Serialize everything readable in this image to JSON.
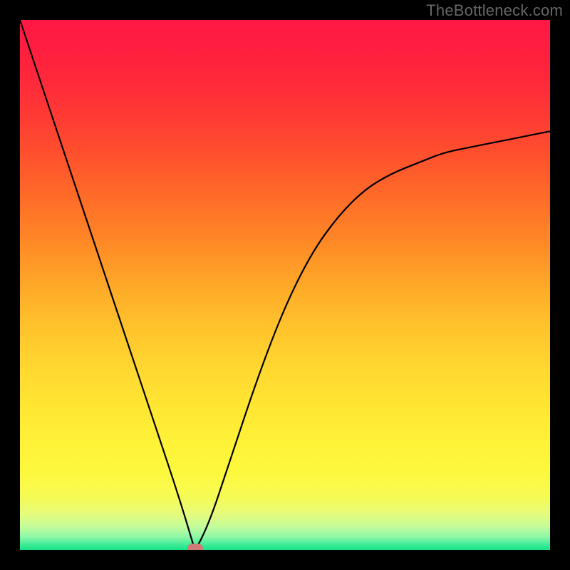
{
  "watermark": "TheBottleneck.com",
  "chart_data": {
    "type": "line",
    "title": "",
    "xlabel": "",
    "ylabel": "",
    "xlim": [
      0,
      100
    ],
    "ylim": [
      0,
      100
    ],
    "x": [
      0,
      5,
      10,
      15,
      20,
      25,
      30,
      33,
      35,
      40,
      45,
      50,
      55,
      60,
      65,
      70,
      75,
      80,
      85,
      90,
      95,
      100
    ],
    "values": [
      100,
      85,
      70,
      55,
      40,
      25,
      10,
      0,
      3,
      18,
      33,
      46,
      56,
      63,
      68,
      71,
      73,
      75,
      76,
      77,
      78,
      79
    ],
    "optimum_x": 33,
    "optimum_y": 0,
    "background_gradient": {
      "stops": [
        {
          "pos": 0.0,
          "color": "#ff1744"
        },
        {
          "pos": 0.06,
          "color": "#ff1f3f"
        },
        {
          "pos": 0.12,
          "color": "#ff2a3a"
        },
        {
          "pos": 0.18,
          "color": "#ff3a34"
        },
        {
          "pos": 0.25,
          "color": "#ff4f2e"
        },
        {
          "pos": 0.33,
          "color": "#ff6a28"
        },
        {
          "pos": 0.42,
          "color": "#ff8926"
        },
        {
          "pos": 0.5,
          "color": "#ffa828"
        },
        {
          "pos": 0.58,
          "color": "#ffc32c"
        },
        {
          "pos": 0.66,
          "color": "#ffd830"
        },
        {
          "pos": 0.74,
          "color": "#ffe833"
        },
        {
          "pos": 0.8,
          "color": "#fff238"
        },
        {
          "pos": 0.85,
          "color": "#fdf83c"
        },
        {
          "pos": 0.9,
          "color": "#f6fb54"
        },
        {
          "pos": 0.93,
          "color": "#e7fc7a"
        },
        {
          "pos": 0.955,
          "color": "#c6fc9a"
        },
        {
          "pos": 0.975,
          "color": "#8ef8a8"
        },
        {
          "pos": 0.99,
          "color": "#3deb97"
        },
        {
          "pos": 1.0,
          "color": "#18e487"
        }
      ]
    }
  }
}
